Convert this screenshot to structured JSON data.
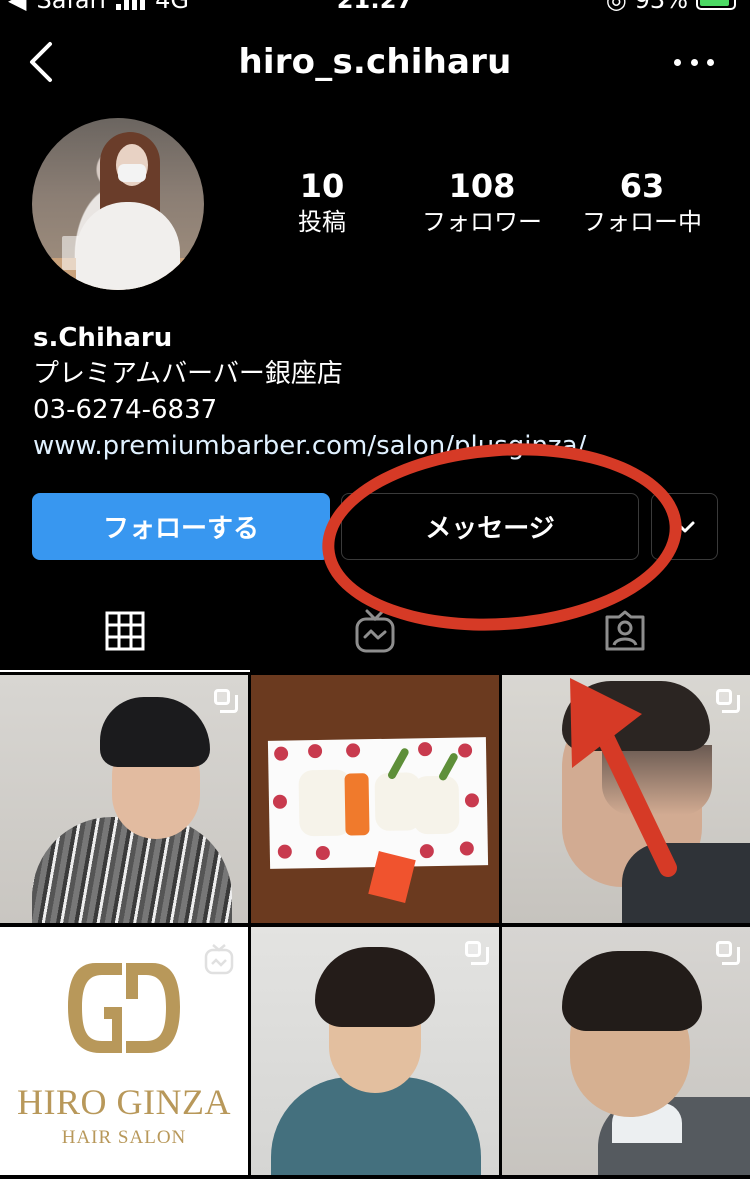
{
  "status_bar": {
    "carrier": "Safari",
    "network": "4G",
    "time": "21:27",
    "battery": "93%"
  },
  "header": {
    "title": "hiro_s.chiharu"
  },
  "stats": [
    {
      "value": "10",
      "label": "投稿"
    },
    {
      "value": "108",
      "label": "フォロワー"
    },
    {
      "value": "63",
      "label": "フォロー中"
    }
  ],
  "bio": {
    "name": "s.Chiharu",
    "line1": "プレミアムバーバー銀座店",
    "phone": "03-6274-6837",
    "link": "www.premiumbarber.com/salon/plusginza/"
  },
  "buttons": {
    "follow": "フォローする",
    "message": "メッセージ"
  },
  "grid": {
    "logo_brand": "HIRO GINZA",
    "logo_sub": "HAIR SALON"
  },
  "colors": {
    "accent": "#3897f0",
    "annotation": "#d63a26",
    "logo_gold": "#b8985a"
  }
}
